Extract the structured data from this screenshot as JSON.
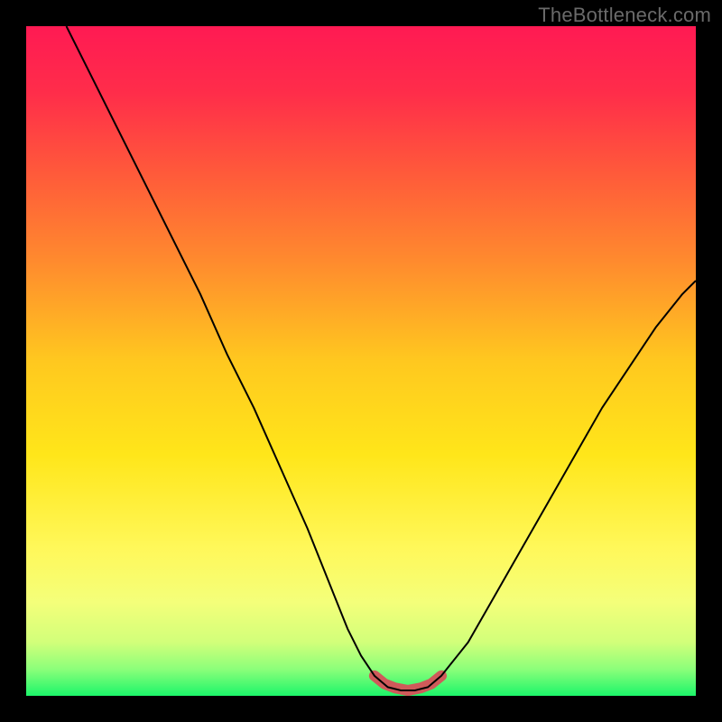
{
  "watermark": "TheBottleneck.com",
  "chart_data": {
    "type": "line",
    "title": "",
    "xlabel": "",
    "ylabel": "",
    "x_range": [
      0,
      100
    ],
    "y_range": [
      0,
      100
    ],
    "series": [
      {
        "name": "curve",
        "x": [
          6,
          10,
          14,
          18,
          22,
          26,
          30,
          34,
          38,
          42,
          46,
          48,
          50,
          52,
          54,
          56,
          58,
          60,
          62,
          66,
          70,
          74,
          78,
          82,
          86,
          90,
          94,
          98,
          100
        ],
        "y": [
          100,
          92,
          84,
          76,
          68,
          60,
          51,
          43,
          34,
          25,
          15,
          10,
          6,
          3,
          1.3,
          0.8,
          0.8,
          1.3,
          3,
          8,
          15,
          22,
          29,
          36,
          43,
          49,
          55,
          60,
          62
        ]
      },
      {
        "name": "highlight",
        "x": [
          52,
          53.5,
          55,
          57,
          59,
          60.5,
          62
        ],
        "y": [
          3,
          1.8,
          1.2,
          0.8,
          1.2,
          1.8,
          3
        ]
      }
    ],
    "gradient_stops": [
      {
        "offset": 0.0,
        "color": "#ff1a53"
      },
      {
        "offset": 0.1,
        "color": "#ff2d4a"
      },
      {
        "offset": 0.22,
        "color": "#ff5a3a"
      },
      {
        "offset": 0.35,
        "color": "#ff8a2e"
      },
      {
        "offset": 0.5,
        "color": "#ffc81f"
      },
      {
        "offset": 0.64,
        "color": "#ffe61a"
      },
      {
        "offset": 0.78,
        "color": "#fff85a"
      },
      {
        "offset": 0.86,
        "color": "#f4ff7a"
      },
      {
        "offset": 0.92,
        "color": "#d2ff7a"
      },
      {
        "offset": 0.96,
        "color": "#8cff7a"
      },
      {
        "offset": 1.0,
        "color": "#1cf56a"
      }
    ],
    "highlight_style": {
      "stroke": "#cf5a5a",
      "stroke_width": 12
    },
    "curve_style": {
      "stroke": "#000000",
      "stroke_width": 2
    }
  }
}
